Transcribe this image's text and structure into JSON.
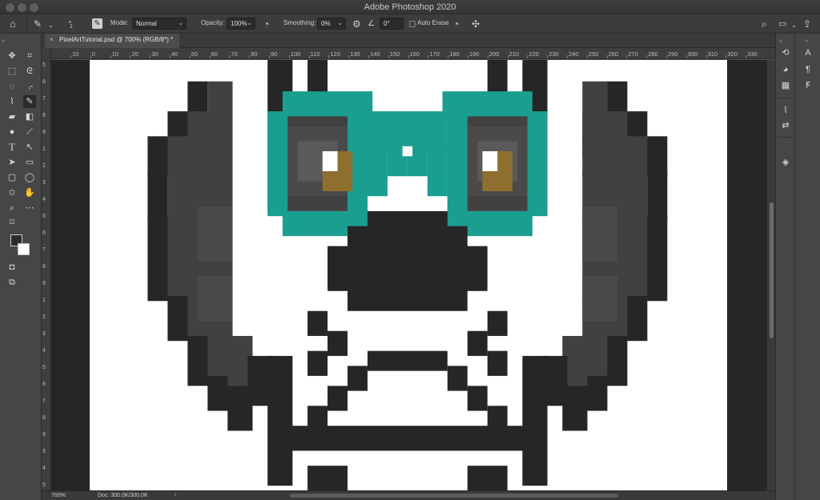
{
  "app": {
    "title": "Adobe Photoshop 2020"
  },
  "options_bar": {
    "brush_size": "1",
    "mode_label": "Mode:",
    "mode_value": "Normal",
    "opacity_label": "Opacity:",
    "opacity_value": "100%",
    "smoothing_label": "Smoothing:",
    "smoothing_value": "0%",
    "angle_value": "0°",
    "auto_erase_label": "Auto Erase"
  },
  "document": {
    "tab_title": "PixelArtTutorial.psd @ 700% (RGB/8*) *",
    "close_glyph": "×"
  },
  "status": {
    "zoom": "700%",
    "doc_info": "Doc: 300.0K/300.0K",
    "arrow": "›"
  },
  "ruler_top": [
    "10",
    "0",
    "10",
    "20",
    "30",
    "40",
    "50",
    "60",
    "70",
    "80",
    "90",
    "100",
    "110",
    "120",
    "130",
    "140",
    "150",
    "160",
    "170",
    "180",
    "190",
    "200",
    "210",
    "220",
    "230",
    "240",
    "250",
    "260",
    "270",
    "280",
    "290",
    "300",
    "310",
    "320",
    "330"
  ],
  "ruler_left": [
    "5",
    "6",
    "7",
    "8",
    "9",
    "1",
    "2",
    "3",
    "4",
    "5",
    "6",
    "7",
    "8",
    "9",
    "1",
    "2",
    "3",
    "4",
    "5",
    "6",
    "7",
    "8",
    "9",
    "3",
    "4",
    "5"
  ],
  "colors": {
    "teal": "#1a9e8f",
    "black": "#262626",
    "dark_gray": "#414141",
    "mid_gray": "#4a4a4a",
    "light_gray": "#5a5a5a",
    "brown": "#8f6f2d",
    "white": "#ffffff"
  },
  "icons": {
    "home": "home-icon",
    "pencil": "pencil-icon",
    "brush_settings": "brush-settings-icon",
    "search": "search-icon",
    "workspace": "workspace-icon",
    "share": "share-icon"
  }
}
